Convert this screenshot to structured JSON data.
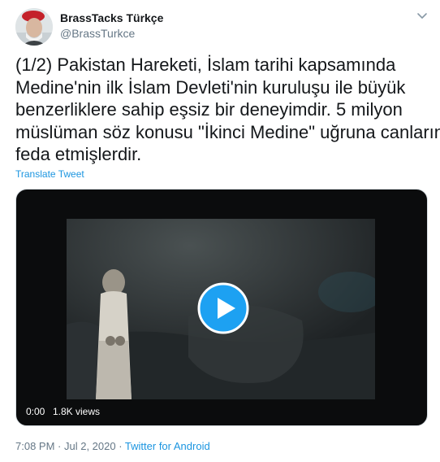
{
  "author": {
    "display_name": "BrassTacks Türkçe",
    "handle": "@BrassTurkce"
  },
  "tweet": {
    "lines": [
      "(1/2) Pakistan Hareketi, İslam tarihi kapsamında",
      "Medine'nin ilk İslam Devleti'nin kuruluşu ile büyük",
      "benzerliklere sahip eşsiz bir deneyimdir. 5 milyon",
      "müslüman söz konusu \"İkinci Medine\" uğruna canlarını",
      "feda etmişlerdir."
    ],
    "translate_label": "Translate Tweet"
  },
  "video": {
    "duration": "0:00",
    "views": "1.8K views",
    "play_icon": "play-icon"
  },
  "meta": {
    "time": "7:08 PM",
    "separator": " · ",
    "date": "Jul 2, 2020",
    "source": "Twitter for Android"
  },
  "colors": {
    "link": "#1b95e0",
    "secondary_text": "#657786",
    "play_button": "#1da1f2"
  },
  "icons": [
    "avatar",
    "chevron-down-icon",
    "play-icon"
  ]
}
